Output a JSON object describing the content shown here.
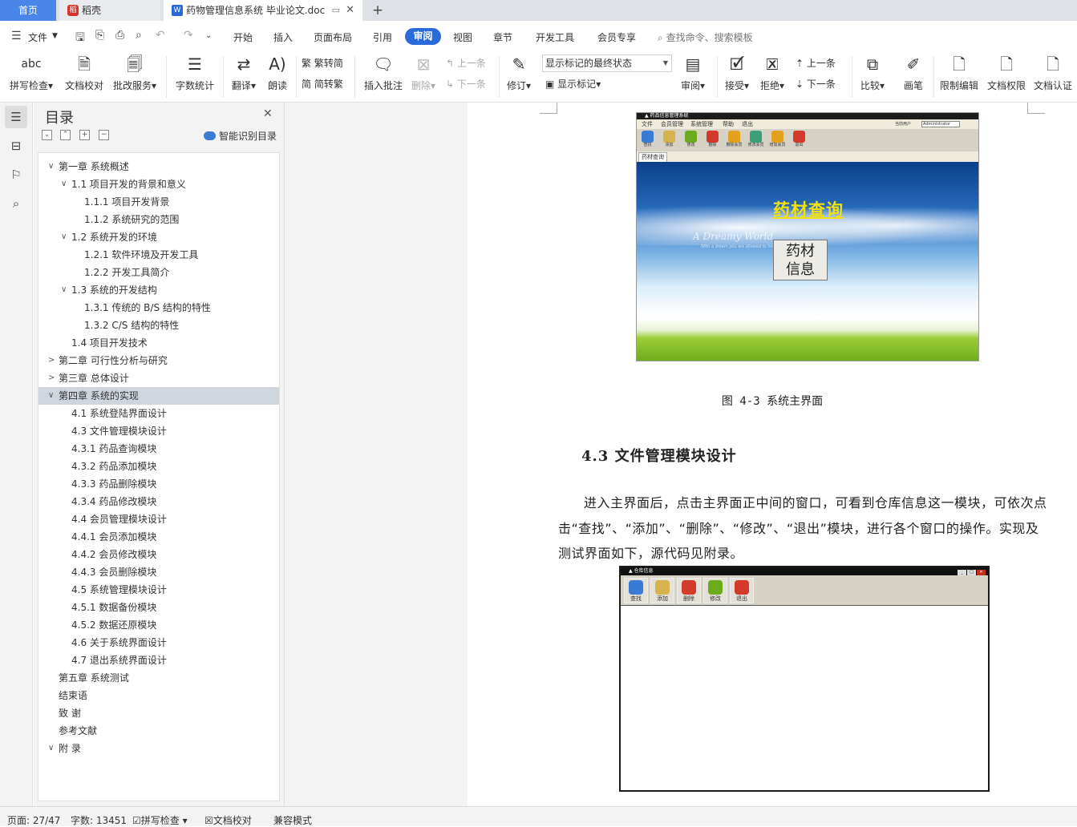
{
  "tabs": {
    "home": "首页",
    "daoke": "稻壳",
    "doc": "药物管理信息系统 毕业论文.doc"
  },
  "menu": {
    "file": "文件",
    "items": [
      "开始",
      "插入",
      "页面布局",
      "引用",
      "审阅",
      "视图",
      "章节",
      "开发工具",
      "会员专享"
    ],
    "search_placeholder": "查找命令、搜索模板"
  },
  "ribbon": {
    "spell": "拼写检查",
    "proof": "文档校对",
    "correct": "批改服务",
    "wordcount": "字数统计",
    "translate": "翻译",
    "read": "朗读",
    "trad2simp": "繁转简",
    "simp2trad": "简转繁",
    "insert_comment": "插入批注",
    "delete": "删除",
    "prev": "上一条",
    "next": "下一条",
    "revise": "修订",
    "markup_state": "显示标记的最终状态",
    "show_markup": "显示标记",
    "review": "审阅",
    "accept": "接受",
    "reject": "拒绝",
    "prev2": "上一条",
    "next2": "下一条",
    "compare": "比较",
    "pen": "画笔",
    "restrict": "限制编辑",
    "permission": "文档权限",
    "certify": "文档认证",
    "spell_icon_text": "abc"
  },
  "toc": {
    "title": "目录",
    "smart": "智能识别目录",
    "items": [
      {
        "text": "第一章  系统概述",
        "level": 0,
        "state": "open"
      },
      {
        "text": "1.1  项目开发的背景和意义",
        "level": 1,
        "state": "open"
      },
      {
        "text": "1.1.1  项目开发背景",
        "level": 2
      },
      {
        "text": "1.1.2  系统研究的范围",
        "level": 2
      },
      {
        "text": "1.2  系统开发的环境",
        "level": 1,
        "state": "open"
      },
      {
        "text": "1.2.1  软件环境及开发工具",
        "level": 2
      },
      {
        "text": "1.2.2  开发工具简介",
        "level": 2
      },
      {
        "text": "1.3  系统的开发结构",
        "level": 1,
        "state": "open"
      },
      {
        "text": "1.3.1  传统的 B/S 结构的特性",
        "level": 2
      },
      {
        "text": "1.3.2 C/S  结构的特性",
        "level": 2
      },
      {
        "text": "1.4  项目开发技术",
        "level": 1
      },
      {
        "text": "第二章  可行性分析与研究",
        "level": 0,
        "state": "closed"
      },
      {
        "text": "第三章  总体设计",
        "level": 0,
        "state": "closed"
      },
      {
        "text": "第四章  系统的实现",
        "level": 0,
        "state": "open",
        "selected": true
      },
      {
        "text": "4.1  系统登陆界面设计",
        "level": 1
      },
      {
        "text": "4.3  文件管理模块设计",
        "level": 1
      },
      {
        "text": "4.3.1 药品查询模块",
        "level": 1
      },
      {
        "text": "4.3.2  药品添加模块",
        "level": 1
      },
      {
        "text": "4.3.3 药品删除模块",
        "level": 1
      },
      {
        "text": "4.3.4 药品修改模块",
        "level": 1
      },
      {
        "text": "4.4 会员管理模块设计",
        "level": 1
      },
      {
        "text": "4.4.1 会员添加模块",
        "level": 1
      },
      {
        "text": "4.4.2 会员修改模块",
        "level": 1
      },
      {
        "text": "4.4.3 会员删除模块",
        "level": 1
      },
      {
        "text": "4.5  系统管理模块设计",
        "level": 1
      },
      {
        "text": "4.5.1  数据备份模块",
        "level": 1
      },
      {
        "text": "4.5.2  数据还原模块",
        "level": 1
      },
      {
        "text": "4.6  关于系统界面设计",
        "level": 1
      },
      {
        "text": "4.7  退出系统界面设计",
        "level": 1
      },
      {
        "text": "第五章  系统测试",
        "level": 0
      },
      {
        "text": "结束语",
        "level": 0
      },
      {
        "text": "致    谢",
        "level": 0
      },
      {
        "text": "参考文献",
        "level": 0
      },
      {
        "text": "附    录",
        "level": 0,
        "state": "open"
      }
    ]
  },
  "doc": {
    "figure1": {
      "menu": [
        "文件",
        "会员管理",
        "系统管理",
        "帮助",
        "退出"
      ],
      "user_label": "当前用户",
      "user_value": "Administrator",
      "toolbar": [
        "查找",
        "添加",
        "修改",
        "删除",
        "删除会员",
        "修改会员",
        "增加会员",
        "退出"
      ],
      "tab": "药材查询",
      "headline": "药材查询",
      "dreamy": "A Dreamy World",
      "dreamy_sub": "With a dream you are allowed to live",
      "button": "药材\n信息"
    },
    "caption1": "图 4-3  系统主界面",
    "heading": "4.3  文件管理模块设计",
    "para": [
      "进入主界面后，点击主界面正中间的窗口，可看到仓库信息这一模块，可依次点",
      "击“查找”、“添加”、“删除”、“修改”、“退出”模块，进行各个窗口的操作。实现及",
      "测试界面如下，源代码见附录。"
    ],
    "figure2": {
      "title": "仓库信息",
      "toolbar": [
        "查找",
        "添加",
        "删除",
        "修改",
        "退出"
      ]
    }
  },
  "status": {
    "page": "页面: 27/47",
    "words": "字数: 13451",
    "spell": "拼写检查",
    "proof": "文档校对",
    "compat": "兼容模式"
  }
}
